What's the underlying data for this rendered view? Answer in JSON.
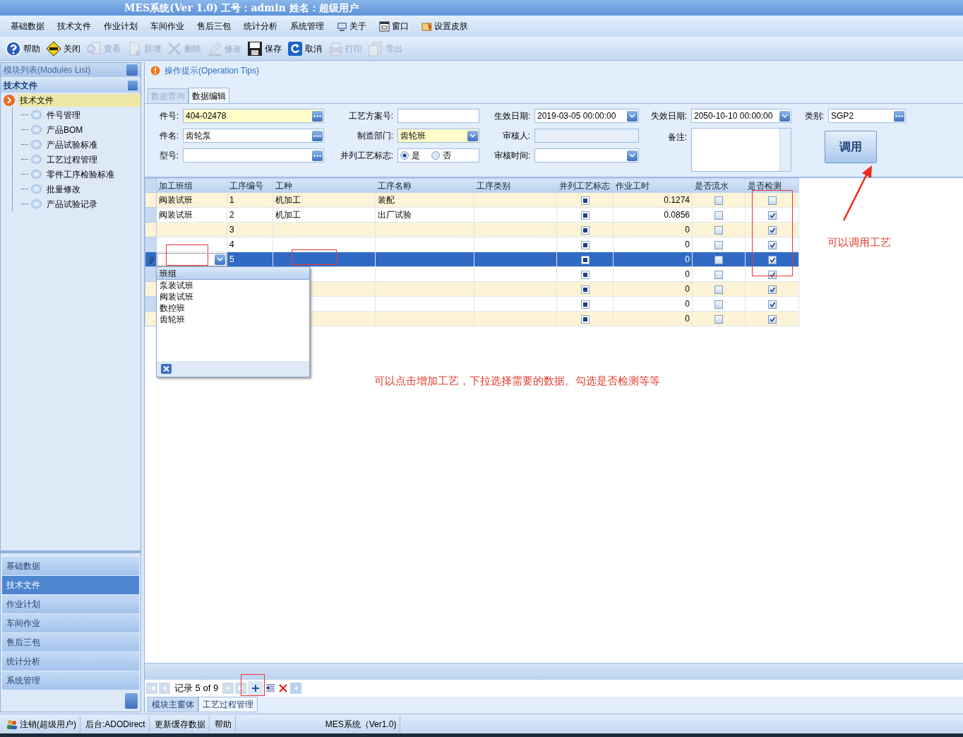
{
  "window": {
    "title": "MES系统(Ver 1.0) 工号：admin  姓名：超级用户"
  },
  "menu": [
    "基础数据",
    "技术文件",
    "作业计划",
    "车间作业",
    "售后三包",
    "统计分析",
    "系统管理",
    "关于",
    "窗口",
    "设置皮肤"
  ],
  "toolbar": [
    {
      "label": "帮助",
      "disabled": false
    },
    {
      "label": "关闭",
      "disabled": false
    },
    {
      "label": "查看",
      "disabled": true
    },
    {
      "label": "新增",
      "disabled": true
    },
    {
      "label": "删除",
      "disabled": true
    },
    {
      "label": "修改",
      "disabled": true
    },
    {
      "label": "保存",
      "disabled": false
    },
    {
      "label": "取消",
      "disabled": false
    },
    {
      "label": "打印",
      "disabled": true
    },
    {
      "label": "导出",
      "disabled": true
    }
  ],
  "sidebar": {
    "header": "模块列表(Modules List)",
    "group": "技术文件",
    "tree": [
      {
        "label": "技术文件",
        "selected": true,
        "children": [
          {
            "label": "件号管理",
            "selected": false
          },
          {
            "label": "产品BOM",
            "selected": false
          },
          {
            "label": "产品试验标准",
            "selected": false
          },
          {
            "label": "工艺过程管理",
            "selected": false
          },
          {
            "label": "零件工序检验标准",
            "selected": false
          },
          {
            "label": "批量修改",
            "selected": false
          },
          {
            "label": "产品试验记录",
            "selected": false
          }
        ]
      }
    ],
    "nav_buttons": [
      {
        "label": "基础数据",
        "selected": false
      },
      {
        "label": "技术文件",
        "selected": true
      },
      {
        "label": "作业计划",
        "selected": false
      },
      {
        "label": "车间作业",
        "selected": false
      },
      {
        "label": "售后三包",
        "selected": false
      },
      {
        "label": "统计分析",
        "selected": false
      },
      {
        "label": "系统管理",
        "selected": false
      }
    ]
  },
  "tips": "操作提示(Operation Tips)",
  "tabs": [
    {
      "label": "数据查询",
      "selected": false
    },
    {
      "label": "数据编辑",
      "selected": true
    }
  ],
  "form": {
    "columns": [
      [
        {
          "label": "件号:",
          "kind": "lookup",
          "value": "404-02478",
          "highlight": true
        },
        {
          "label": "件名:",
          "kind": "lookup",
          "value": "齿轮泵",
          "highlight": false
        },
        {
          "label": "型号:",
          "kind": "lookup",
          "highlight": false
        }
      ],
      [
        {
          "label": "工艺方案号:",
          "kind": "text",
          "highlight": false
        },
        {
          "label": "制造部门:",
          "kind": "combo",
          "value": "齿轮班",
          "highlight": true
        },
        {
          "label": "并列工艺标志:",
          "kind": "radio",
          "options": [
            {
              "label": "是",
              "selected": true
            },
            {
              "label": "否",
              "selected": false
            }
          ]
        }
      ],
      [
        {
          "label": "生效日期:",
          "kind": "combo",
          "value": "2019-03-05 00:00:00",
          "highlight": false
        },
        {
          "label": "审核人:",
          "kind": "readonly",
          "highlight": false
        },
        {
          "label": "审核时间:",
          "kind": "combo",
          "highlight": false
        }
      ],
      [
        {
          "label": "失效日期:",
          "kind": "combo",
          "value": "2050-10-10 00:00:00",
          "highlight": false
        },
        {
          "label": "备注:",
          "kind": "memo",
          "highlight": false
        }
      ],
      [
        {
          "label": "类别:",
          "kind": "lookup",
          "value": "SGP2",
          "highlight": false
        }
      ]
    ],
    "button": "调用"
  },
  "grid": {
    "columns": [
      "加工班组",
      "工序编号",
      "工种",
      "工序名称",
      "工序类别",
      "并列工艺标志",
      "作业工时",
      "是否流水",
      "是否检测"
    ],
    "rows": [
      {
        "group": "阀装试班",
        "seq": "1",
        "type": "机加工",
        "name": "装配",
        "parallel": true,
        "hours": "0.1274",
        "flow": false,
        "inspect": false,
        "selected": false
      },
      {
        "group": "阀装试班",
        "seq": "2",
        "type": "机加工",
        "name": "出厂试验",
        "parallel": true,
        "hours": "0.0856",
        "flow": false,
        "inspect": true,
        "selected": false
      },
      {
        "seq": "3",
        "parallel": true,
        "hours": "0",
        "flow": false,
        "inspect": true,
        "selected": false
      },
      {
        "seq": "4",
        "parallel": true,
        "hours": "0",
        "flow": false,
        "inspect": true,
        "selected": false
      },
      {
        "seq": "5",
        "parallel": true,
        "hours": "0",
        "flow": false,
        "inspect": true,
        "selected": true,
        "editing": true
      },
      {
        "parallel": true,
        "hours": "0",
        "flow": false,
        "inspect": true,
        "selected": false
      },
      {
        "parallel": true,
        "hours": "0",
        "flow": false,
        "inspect": true,
        "selected": false
      },
      {
        "parallel": true,
        "hours": "0",
        "flow": false,
        "inspect": true,
        "selected": false
      },
      {
        "parallel": true,
        "hours": "0",
        "flow": false,
        "inspect": true,
        "selected": false
      }
    ],
    "dropdown": {
      "header": "班组",
      "items": [
        "泵装试班",
        "阀装试班",
        "数控班",
        "齿轮班"
      ]
    }
  },
  "pager": {
    "label": "记录 5 of 9"
  },
  "bottom_tabs": [
    {
      "label": "模块主窗体",
      "selected": false
    },
    {
      "label": "工艺过程管理",
      "selected": true
    }
  ],
  "annotations": [
    "可以调用工艺",
    "可以点击增加工艺，下拉选择需要的数据。勾选是否检测等等"
  ],
  "status_bar": [
    "注销(超级用户)",
    "后台:ADODirect",
    "更新缓存数据",
    "帮助",
    "MES系统（Ver1.0)"
  ]
}
